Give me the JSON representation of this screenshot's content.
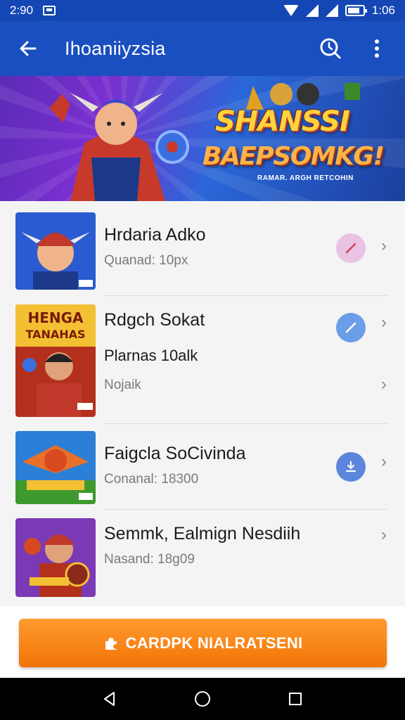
{
  "status_bar": {
    "time_left": "2:90",
    "time_right": "1:06"
  },
  "app_bar": {
    "title": "Ihoaniiyzsia"
  },
  "banner": {
    "title_line1": "SHANSSI",
    "title_line2": "BAEPSOMKG!",
    "subtitle": "RAMAR. ARGH RETCOHIN"
  },
  "list": {
    "items": [
      {
        "title": "Hrdaria Adko",
        "subtitle": "Quanad: 10px",
        "action_color": "#e8c3e3",
        "action_icon": "slash-icon"
      },
      {
        "title": "Rdgch Sokat",
        "middle": "Plarnas 10alk",
        "subtitle": "Nojaik",
        "action_color": "#6c9de8",
        "action_icon": "edit-icon"
      },
      {
        "title": "Faigcla SoCivinda",
        "subtitle": "Conanal: 18300",
        "action_color": "#5c86db",
        "action_icon": "download-icon"
      },
      {
        "title": "Semmk, Ealmign Nesdiih",
        "subtitle": "Nasand: 18g09"
      }
    ]
  },
  "cta": {
    "label": "CARDPK NIALRATSENI"
  },
  "colors": {
    "app_bar": "#1a4fc0",
    "cta": "#f27407"
  }
}
